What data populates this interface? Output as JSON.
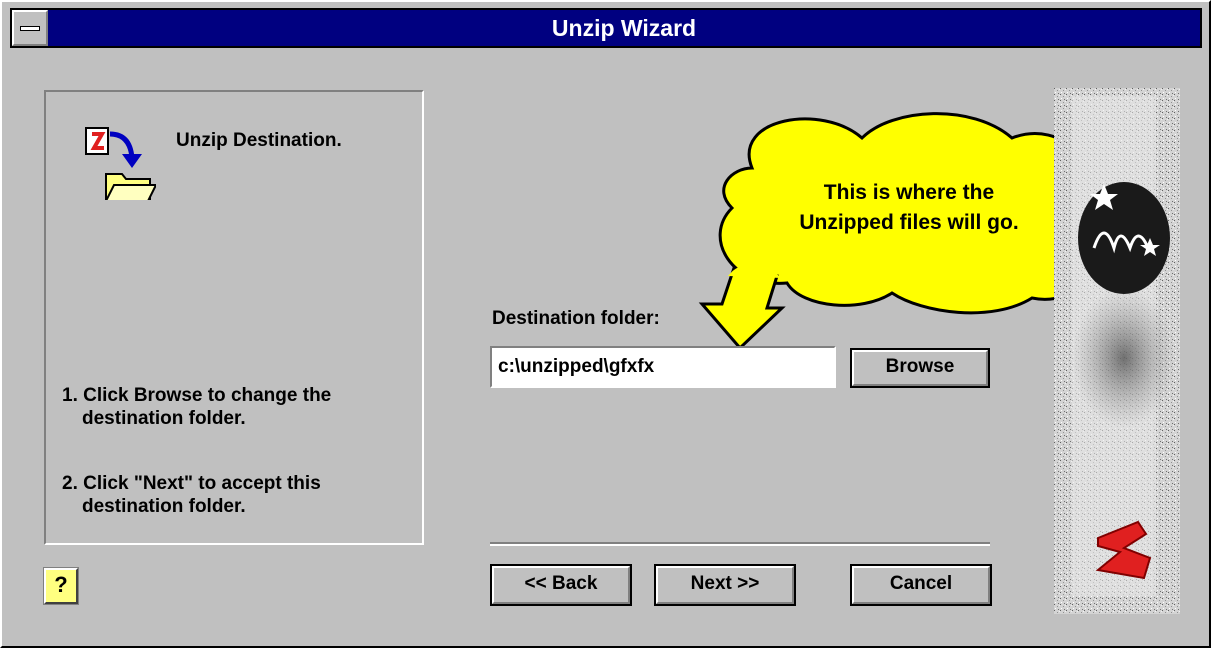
{
  "window": {
    "title": "Unzip Wizard"
  },
  "left_panel": {
    "heading": "Unzip Destination.",
    "step1_line1": "1. Click Browse to change the",
    "step1_line2": "destination folder.",
    "step2_line1": "2.  Click \"Next\" to accept this",
    "step2_line2": "destination folder."
  },
  "help": {
    "label": "?"
  },
  "destination": {
    "label": "Destination folder:",
    "value": "c:\\unzipped\\gfxfx",
    "browse_label": "Browse"
  },
  "callout": {
    "line1": "This is where the",
    "line2": "Unzipped files will go."
  },
  "buttons": {
    "back_label": "<< Back",
    "next_label": "Next >>",
    "cancel_label": "Cancel"
  },
  "colors": {
    "titlebar": "#000080",
    "face": "#c0c0c0",
    "callout_fill": "#ffff00",
    "logo_red": "#e02020"
  }
}
